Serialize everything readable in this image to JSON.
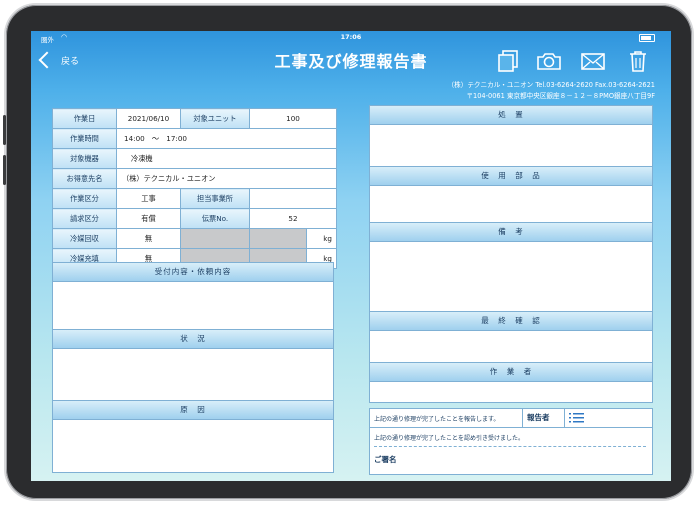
{
  "status": {
    "carrier": "圏外",
    "time": "17:06"
  },
  "nav": {
    "back_label": "戻る",
    "title": "工事及び修理報告書",
    "icons": [
      "copy-icon",
      "camera-icon",
      "mail-icon",
      "trash-icon"
    ]
  },
  "company": {
    "line1": "（株）テクニカル・ユニオン  Tel.03-6264-2620 Fax.03-6264-2621",
    "line2": "〒104-0061 東京都中央区銀座８－１２－８PMO銀座八丁目9F"
  },
  "info": {
    "work_date_label": "作業日",
    "work_date": "2021/06/10",
    "unit_label": "対象ユニット",
    "unit": "100",
    "work_time_label": "作業時間",
    "work_time": "14:00　～　17:00",
    "equipment_label": "対象機器",
    "equipment": "冷凍機",
    "customer_label": "お得意先名",
    "customer": "（株）テクニカル・ユニオン",
    "work_type_label": "作業区分",
    "work_type": "工事",
    "office_label": "担当事業所",
    "office": "",
    "billing_label": "請求区分",
    "billing": "有償",
    "slip_label": "伝票No.",
    "slip": "52",
    "refrig_recovery_label": "冷媒回収",
    "refrig_recovery": "無",
    "refrig_recovery_unit": "kg",
    "refrig_fill_label": "冷媒充填",
    "refrig_fill": "無",
    "refrig_fill_unit": "kg"
  },
  "left_sections": {
    "request": "受付内容・依頼内容",
    "situation": "状　況",
    "cause": "原　因"
  },
  "right_sections": {
    "treatment": "処　置",
    "parts": "使　用　部　品",
    "remarks": "備　考",
    "final_check": "最　終　確　認",
    "worker": "作　業　者"
  },
  "signature": {
    "report_text": "上記の通り修理が完了したことを報告します。",
    "reporter_label": "報告者",
    "accept_text": "上記の通り修理が完了したことを認め引き受けました。",
    "sign_label": "ご署名"
  }
}
